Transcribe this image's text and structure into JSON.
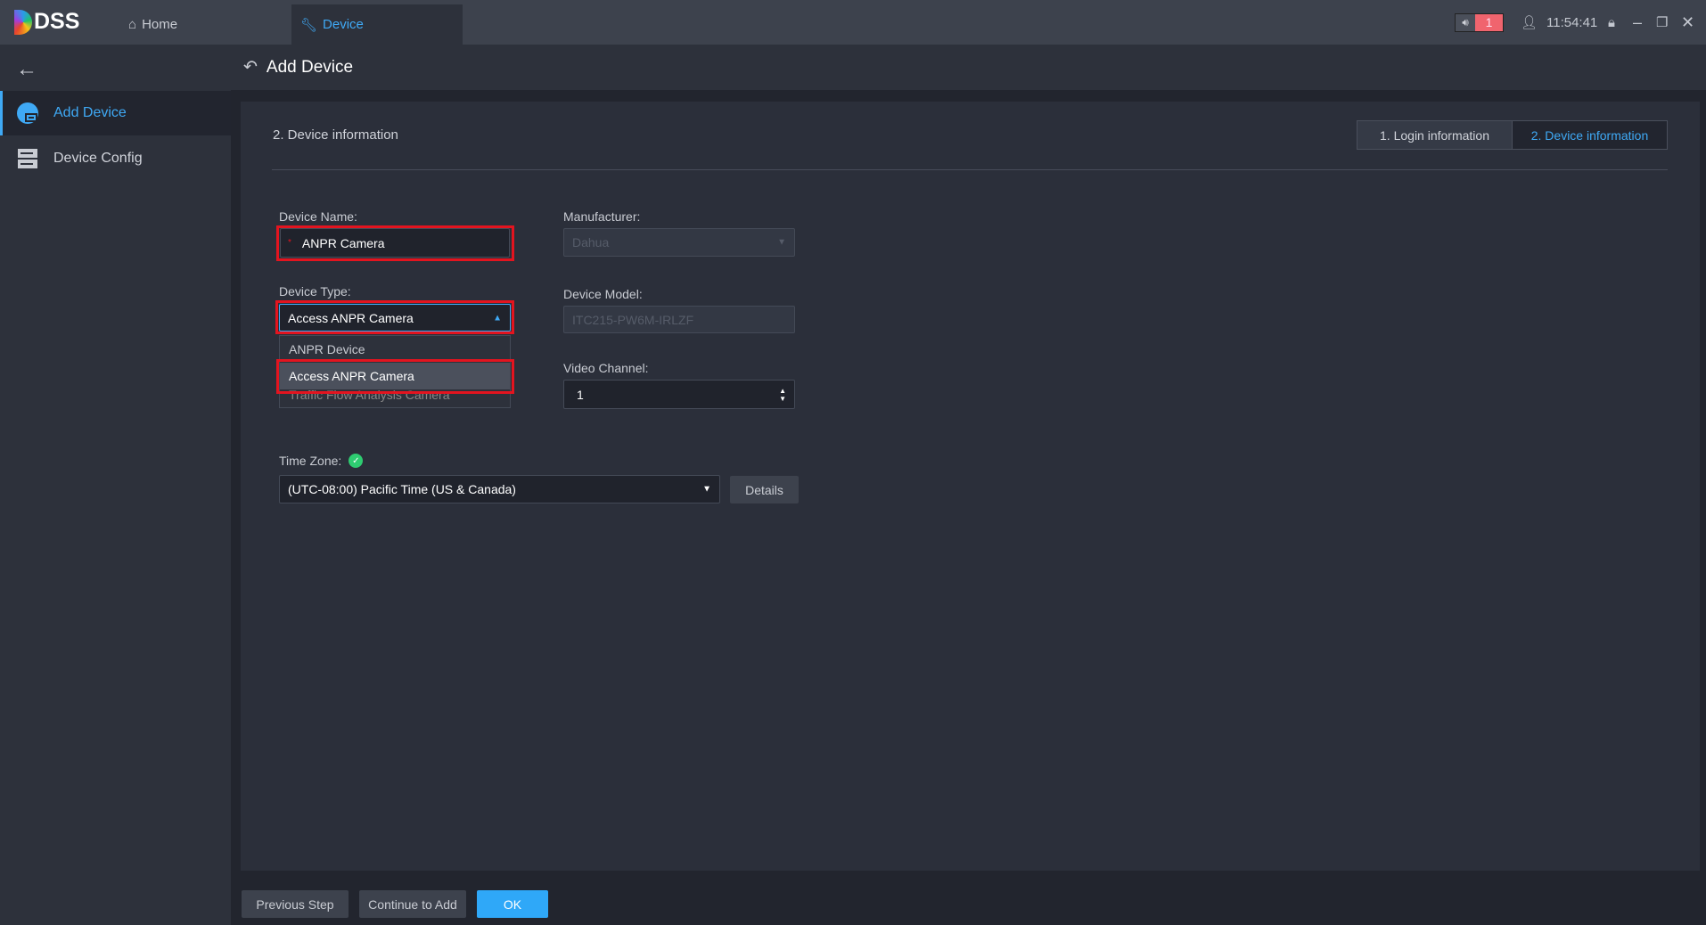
{
  "app": {
    "logo": "DSS",
    "tabs": [
      {
        "label": "Home",
        "icon": "home-icon"
      },
      {
        "label": "Device",
        "icon": "wrench-icon"
      }
    ],
    "alarm_count": "1",
    "time": "11:54:41"
  },
  "sidebar": {
    "items": [
      {
        "label": "Add Device",
        "icon": "add-device-icon",
        "active": true
      },
      {
        "label": "Device Config",
        "icon": "device-config-icon"
      }
    ]
  },
  "header": {
    "title": "Add Device"
  },
  "panel": {
    "section_title": "2. Device information",
    "steps": [
      "1. Login information",
      "2. Device information"
    ]
  },
  "form": {
    "device_name": {
      "label": "Device Name:",
      "value": "ANPR Camera",
      "required_mark": "*"
    },
    "manufacturer": {
      "label": "Manufacturer:",
      "value": "Dahua"
    },
    "device_type": {
      "label": "Device Type:",
      "value": "Access ANPR Camera",
      "options": [
        "ANPR Device",
        "Access ANPR Camera",
        "Traffic Flow Analysis Camera"
      ]
    },
    "device_model": {
      "label": "Device Model:",
      "value": "ITC215-PW6M-IRLZF"
    },
    "video_channel": {
      "label": "Video Channel:",
      "value": "1"
    },
    "time_zone": {
      "label": "Time Zone:",
      "value": "(UTC-08:00) Pacific Time (US & Canada)",
      "details": "Details"
    }
  },
  "footer": {
    "previous": "Previous Step",
    "continue": "Continue to Add",
    "ok": "OK"
  },
  "colors": {
    "accent": "#3fa9f5",
    "highlight": "#e3141f",
    "alarm": "#f0646e",
    "ok_button": "#2fa8f8"
  }
}
